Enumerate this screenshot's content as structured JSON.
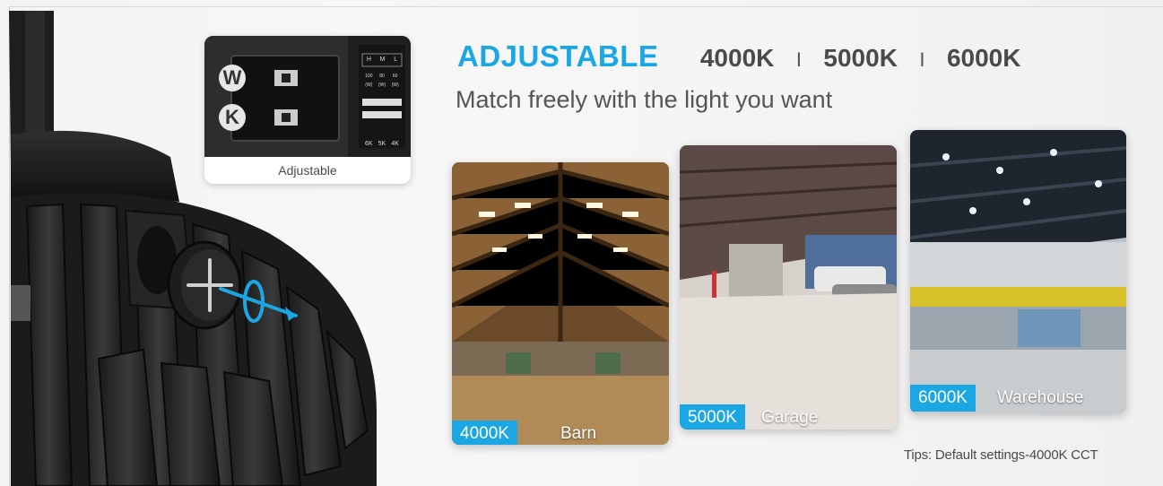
{
  "inset": {
    "caption": "Adjustable",
    "switch_letters": [
      "W",
      "K"
    ],
    "switch_table": {
      "header": [
        "H",
        "M",
        "L"
      ],
      "watts": [
        "100 (W)",
        "80 (W)",
        "60 (W)"
      ],
      "cct": [
        "6K",
        "5K",
        "4K"
      ]
    }
  },
  "headline": {
    "adjustable": "ADJUSTABLE",
    "cct_options": [
      "4000K",
      "5000K",
      "6000K"
    ],
    "separator": "I",
    "subtitle": "Match freely with the light you want"
  },
  "scenes": [
    {
      "cct": "4000K",
      "place": "Barn"
    },
    {
      "cct": "5000K",
      "place": "Garage"
    },
    {
      "cct": "6000K",
      "place": "Warehouse"
    }
  ],
  "tips": "Tips: Default settings-4000K CCT",
  "colors": {
    "accent": "#1aa7e3",
    "text": "#4a4a4a"
  }
}
